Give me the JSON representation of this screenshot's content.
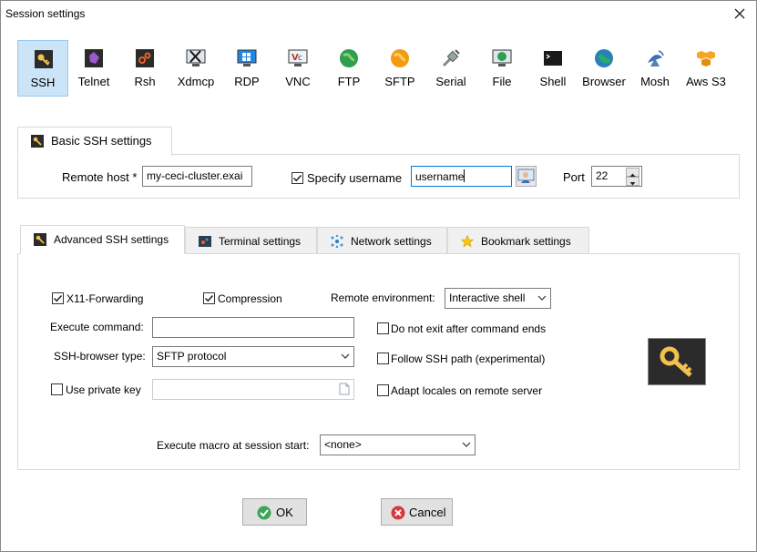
{
  "window": {
    "title": "Session settings"
  },
  "protocols": [
    {
      "label": "SSH",
      "icon": "ssh-icon",
      "selected": true
    },
    {
      "label": "Telnet",
      "icon": "telnet-icon"
    },
    {
      "label": "Rsh",
      "icon": "rsh-icon"
    },
    {
      "label": "Xdmcp",
      "icon": "xdmcp-icon"
    },
    {
      "label": "RDP",
      "icon": "rdp-icon"
    },
    {
      "label": "VNC",
      "icon": "vnc-icon"
    },
    {
      "label": "FTP",
      "icon": "ftp-icon"
    },
    {
      "label": "SFTP",
      "icon": "sftp-icon"
    },
    {
      "label": "Serial",
      "icon": "serial-icon"
    },
    {
      "label": "File",
      "icon": "file-icon"
    },
    {
      "label": "Shell",
      "icon": "shell-icon"
    },
    {
      "label": "Browser",
      "icon": "browser-icon"
    },
    {
      "label": "Mosh",
      "icon": "mosh-icon"
    },
    {
      "label": "Aws S3",
      "icon": "aws-s3-icon"
    }
  ],
  "basic": {
    "tab_label": "Basic SSH settings",
    "remote_host_label": "Remote host *",
    "remote_host_value": "my-ceci-cluster.exai",
    "specify_username_label": "Specify username",
    "specify_username_checked": true,
    "username_value": "username",
    "port_label": "Port",
    "port_value": "22"
  },
  "advanced_tabs": [
    {
      "label": "Advanced SSH settings",
      "active": true
    },
    {
      "label": "Terminal settings"
    },
    {
      "label": "Network settings"
    },
    {
      "label": "Bookmark settings"
    }
  ],
  "advanced": {
    "x11_label": "X11-Forwarding",
    "x11_checked": true,
    "compression_label": "Compression",
    "compression_checked": true,
    "remote_env_label": "Remote environment:",
    "remote_env_value": "Interactive shell",
    "execute_command_label": "Execute command:",
    "execute_command_value": "",
    "do_not_exit_label": "Do not exit after command ends",
    "do_not_exit_checked": false,
    "browser_type_label": "SSH-browser type:",
    "browser_type_value": "SFTP protocol",
    "follow_path_label": "Follow SSH path (experimental)",
    "follow_path_checked": false,
    "private_key_label": "Use private key",
    "private_key_checked": false,
    "adapt_locales_label": "Adapt locales on remote server",
    "adapt_locales_checked": false,
    "macro_label": "Execute macro at session start:",
    "macro_value": "<none>"
  },
  "buttons": {
    "ok": "OK",
    "cancel": "Cancel"
  },
  "colors": {
    "selection": "#cce4f7",
    "focus_border": "#0078d7",
    "key_badge_bg": "#2b2b2b",
    "key_gold": "#f2c14e",
    "ok_green": "#3aa757",
    "cancel_red": "#d9363e"
  }
}
